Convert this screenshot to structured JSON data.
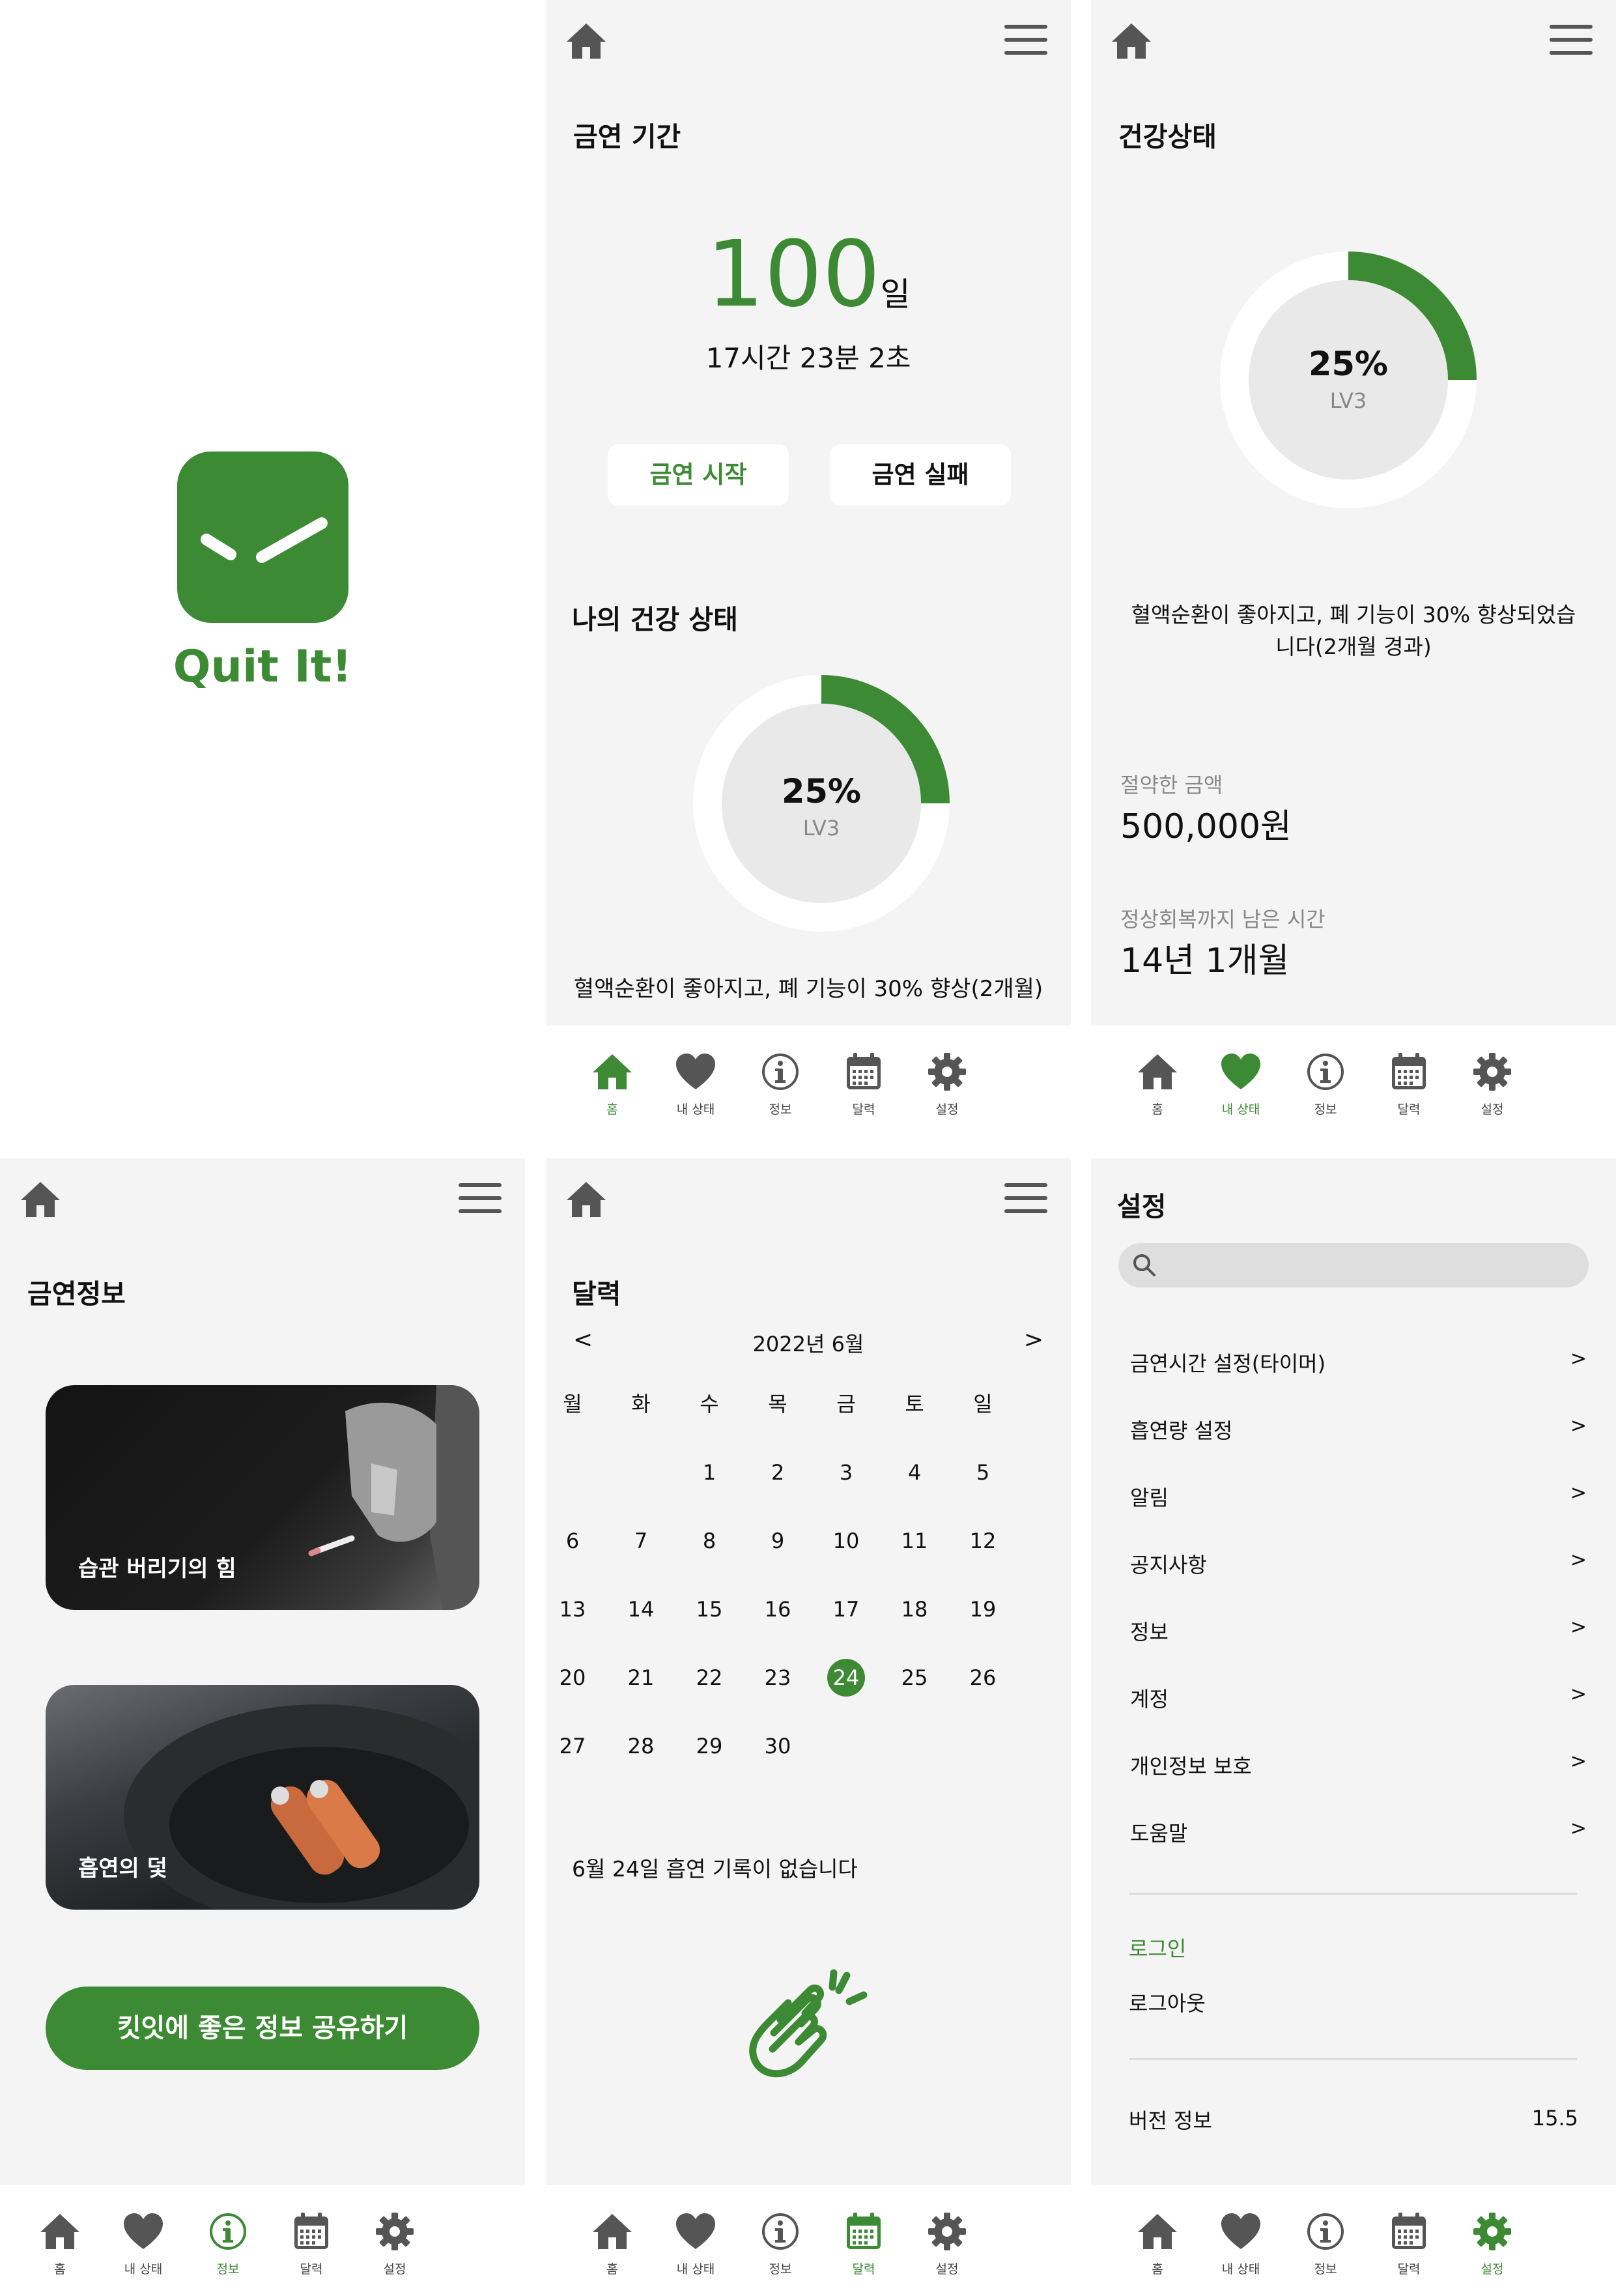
{
  "colors": {
    "green": "#3d8a35",
    "ring_bg": "#e9e9e9",
    "gray_text": "#888888",
    "panel_bg": "#f4f4f4"
  },
  "tabs": [
    {
      "label": "홈",
      "icon": "home-icon"
    },
    {
      "label": "내 상태",
      "icon": "heart-icon"
    },
    {
      "label": "정보",
      "icon": "info-icon"
    },
    {
      "label": "달력",
      "icon": "calendar-icon"
    },
    {
      "label": "설정",
      "icon": "gear-icon"
    }
  ],
  "splash": {
    "app_name": "Quit It!"
  },
  "home": {
    "section_title": "금연 기간",
    "days": "100",
    "days_unit": "일",
    "elapsed": "17시간 23분 2초",
    "start_button": "금연 시작",
    "fail_button": "금연 실패",
    "health_title": "나의 건강 상태",
    "progress_percent": 25,
    "progress_label": "25%",
    "level": "LV3",
    "health_message": "혈액순환이 좋아지고, 폐 기능이 30% 향상(2개월)"
  },
  "status": {
    "title": "건강상태",
    "progress_percent": 25,
    "progress_label": "25%",
    "level": "LV3",
    "message_line1": "혈액순환이 좋아지고, 폐 기능이 30% 향상되었습",
    "message_line2": "니다(2개월 경과)",
    "saved_label": "절약한 금액",
    "saved_value": "500,000원",
    "recovery_label": "정상회복까지 남은 시간",
    "recovery_value": "14년 1개월"
  },
  "info": {
    "title": "금연정보",
    "card1": "습관 버리기의 힘",
    "card2": "흡연의 덫",
    "share_button": "킷잇에 좋은 정보 공유하기"
  },
  "calendar": {
    "title": "달력",
    "prev": "<",
    "next": ">",
    "month_label": "2022년 6월",
    "weekdays": [
      "월",
      "화",
      "수",
      "목",
      "금",
      "토",
      "일"
    ],
    "first_weekday_index": 2,
    "days_in_month": 30,
    "selected_day": 24,
    "record_message": "6월 24일 흡연 기록이 없습니다"
  },
  "settings": {
    "title": "설정",
    "search_placeholder": "",
    "items": [
      {
        "label": "금연시간 설정(타이머)",
        "chev": ">"
      },
      {
        "label": "흡연량 설정",
        "chev": ">"
      },
      {
        "label": "알림",
        "chev": ">"
      },
      {
        "label": "공지사항",
        "chev": ">"
      },
      {
        "label": "정보",
        "chev": ">"
      },
      {
        "label": "계정",
        "chev": ">"
      },
      {
        "label": "개인정보 보호",
        "chev": ">"
      },
      {
        "label": "도움말",
        "chev": ">"
      }
    ],
    "login": "로그인",
    "logout": "로그아웃",
    "version_label": "버전 정보",
    "version_value": "15.5"
  }
}
